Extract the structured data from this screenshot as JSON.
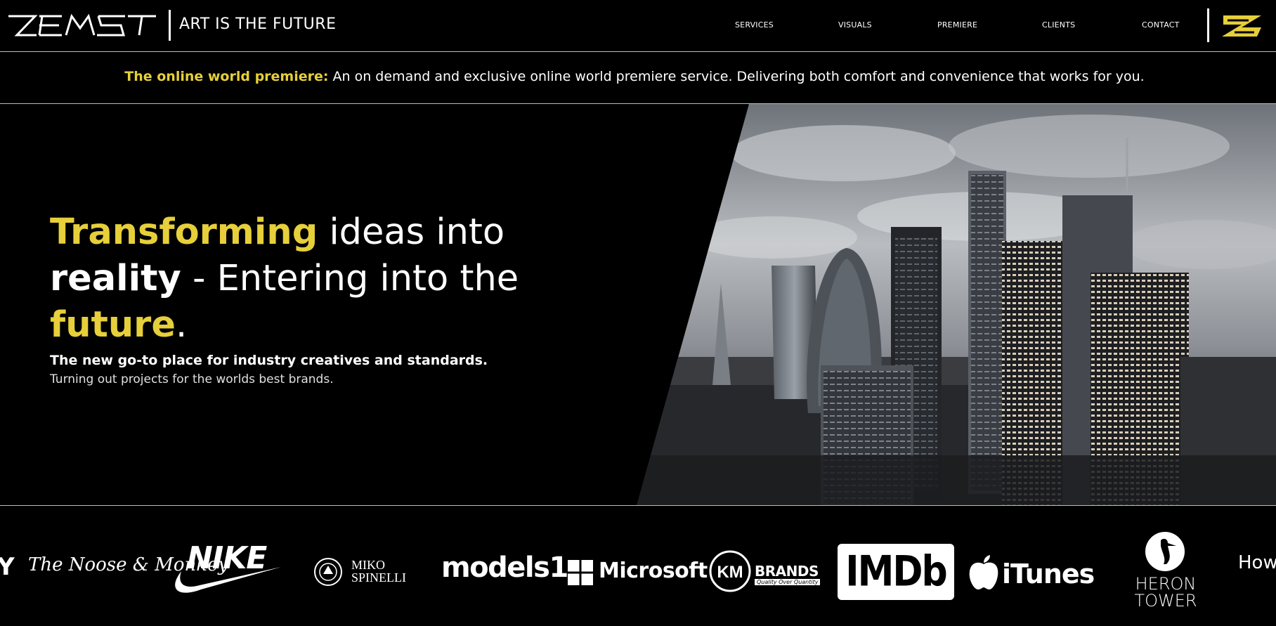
{
  "header": {
    "tagline": "ART IS THE FUTURE",
    "logo_text": "ZEMS",
    "nav": [
      {
        "label": "SERVICES"
      },
      {
        "label": "VISUALS"
      },
      {
        "label": "PREMIERE"
      },
      {
        "label": "CLIENTS"
      },
      {
        "label": "CONTACT"
      }
    ]
  },
  "announcement": {
    "label": "The online world premiere:",
    "text": " An on demand and exclusive online world premiere service. Delivering both comfort and convenience that works for you."
  },
  "hero": {
    "line1_accent": "Transforming",
    "line1_rest": " ideas into",
    "line2_bold": "reality",
    "line2_rest": " - Entering into the",
    "line3_accent": "future",
    "line3_rest": ".",
    "sub1": "The new go-to place for industry creatives and standards.",
    "sub2": "Turning out projects for the worlds best brands."
  },
  "clients": {
    "items": [
      {
        "name": "Y"
      },
      {
        "name": "The Noose & Monkey"
      },
      {
        "name": "NIKE"
      },
      {
        "name": "MIKO SPINELLI"
      },
      {
        "name": "models1"
      },
      {
        "name": "Microsoft"
      },
      {
        "name": "KM BRANDS",
        "tagline": "Quality Over Quantity"
      },
      {
        "name": "IMDb"
      },
      {
        "name": "iTunes"
      },
      {
        "name": "HERON TOWER"
      },
      {
        "name": "How"
      }
    ]
  },
  "colors": {
    "accent": "#e6cf3a",
    "background": "#000000",
    "text": "#ffffff"
  }
}
